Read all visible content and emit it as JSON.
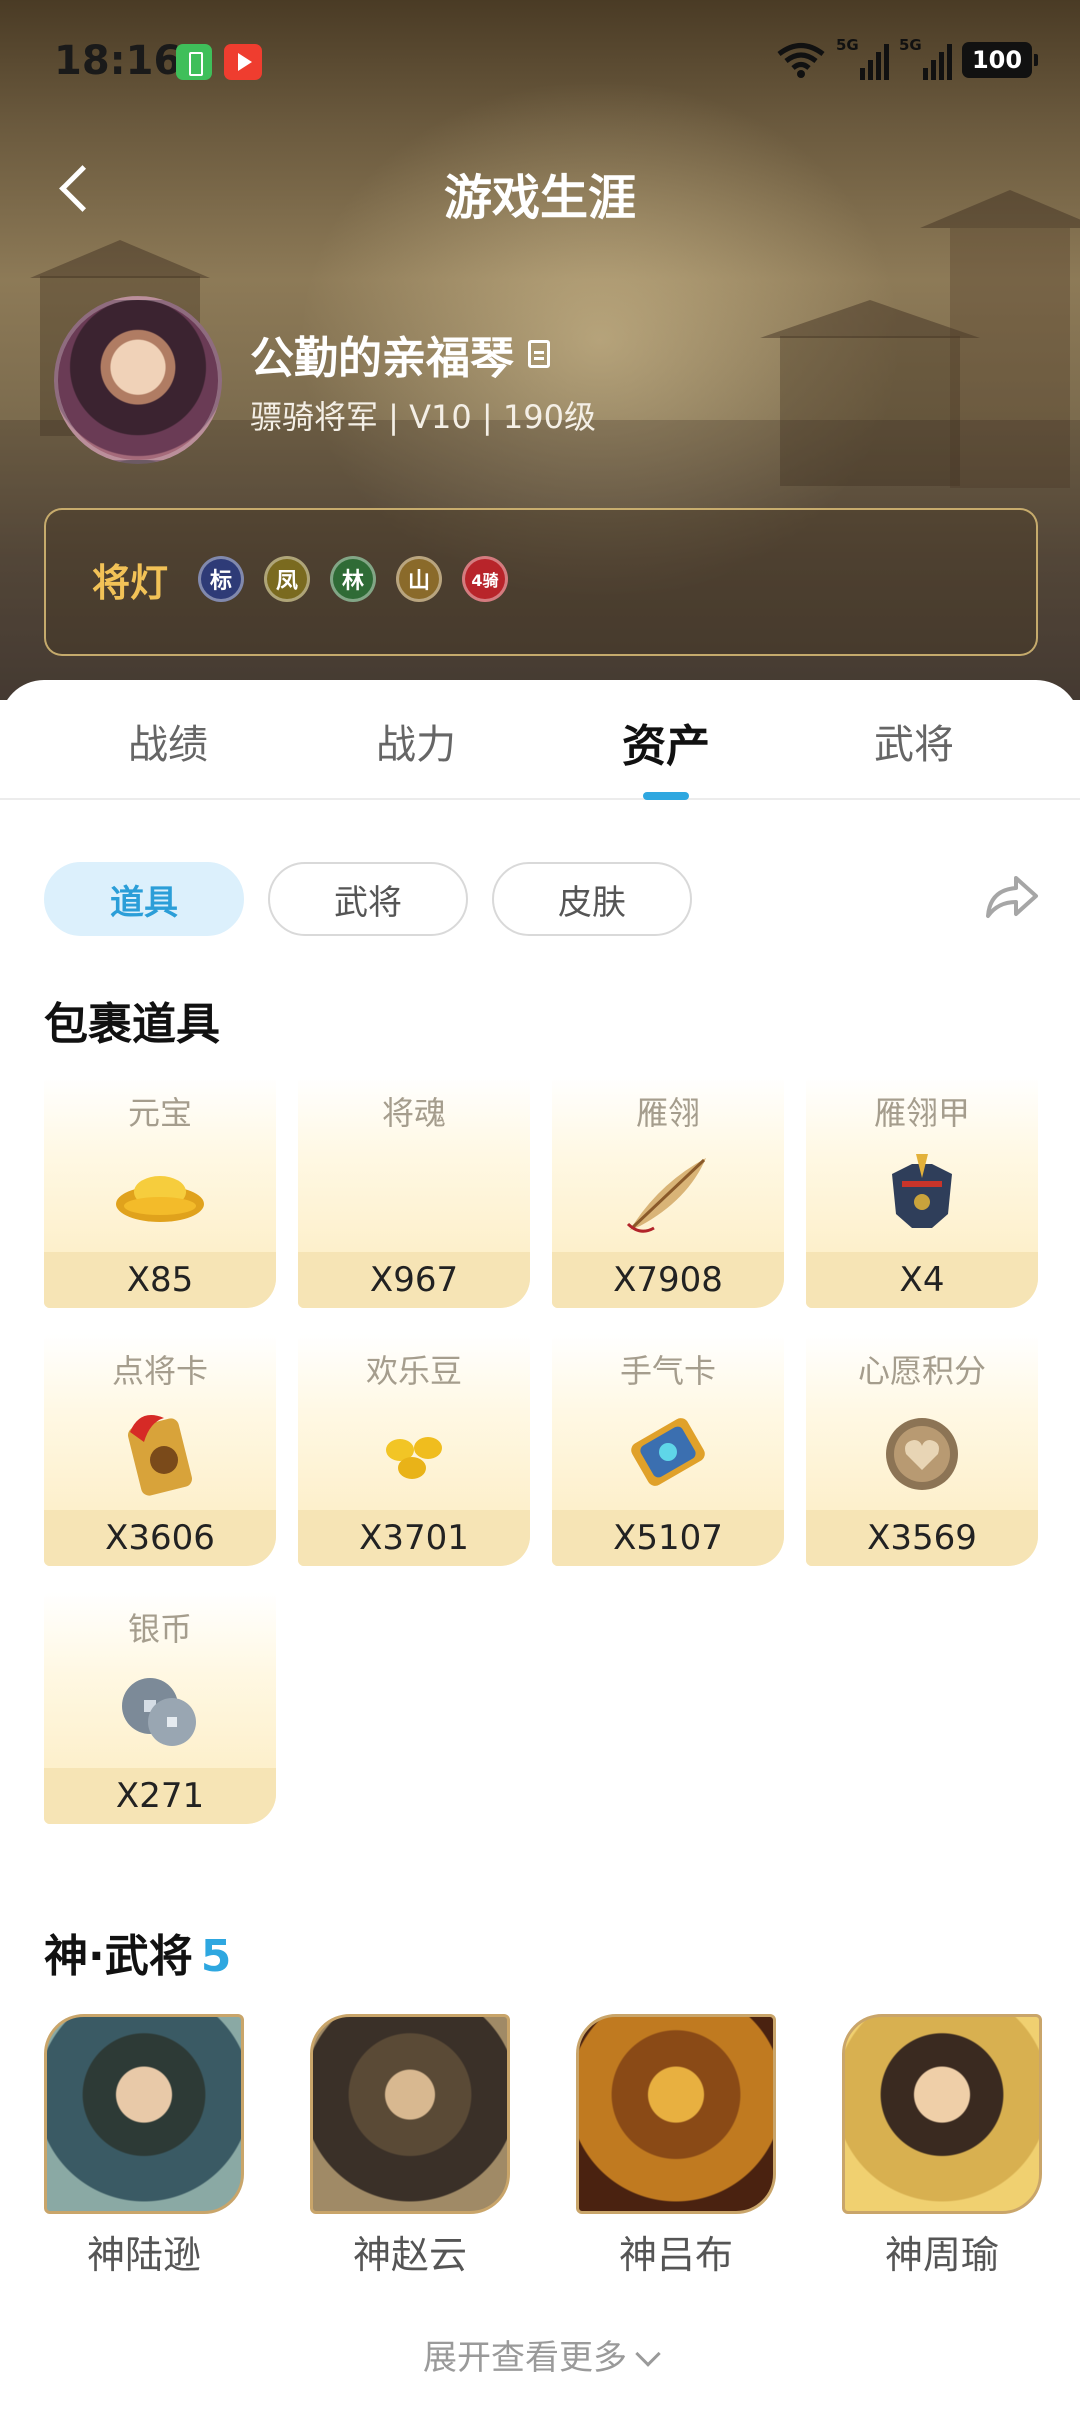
{
  "status_bar": {
    "time": "18:16",
    "signal1_label": "5G",
    "signal2_label": "5G",
    "battery": "100"
  },
  "header": {
    "title": "游戏生涯"
  },
  "profile": {
    "name": "公勤的亲福琴",
    "subtitle": "骠骑将军 | V10 | 190级"
  },
  "lamps": {
    "title": "将灯",
    "items": [
      "标",
      "凤",
      "林",
      "山",
      "4骑"
    ]
  },
  "tabs": [
    "战绩",
    "战力",
    "资产",
    "武将"
  ],
  "active_tab": "资产",
  "chips": [
    "道具",
    "武将",
    "皮肤"
  ],
  "active_chip": "道具",
  "inventory": {
    "title": "包裹道具",
    "items": [
      {
        "name": "元宝",
        "qty": "X85",
        "icon": "gold-ingot-icon"
      },
      {
        "name": "将魂",
        "qty": "X967",
        "icon": ""
      },
      {
        "name": "雁翎",
        "qty": "X7908",
        "icon": "feather-icon"
      },
      {
        "name": "雁翎甲",
        "qty": "X4",
        "icon": "armor-icon"
      },
      {
        "name": "点将卡",
        "qty": "X3606",
        "icon": "general-card-icon"
      },
      {
        "name": "欢乐豆",
        "qty": "X3701",
        "icon": "beans-icon"
      },
      {
        "name": "手气卡",
        "qty": "X5107",
        "icon": "luck-card-icon"
      },
      {
        "name": "心愿积分",
        "qty": "X3569",
        "icon": "heart-coin-icon"
      },
      {
        "name": "银币",
        "qty": "X271",
        "icon": "silver-coin-icon"
      }
    ]
  },
  "generals": {
    "title": "神·武将",
    "count": "5",
    "items": [
      {
        "name": "神陆逊"
      },
      {
        "name": "神赵云"
      },
      {
        "name": "神吕布"
      },
      {
        "name": "神周瑜"
      }
    ]
  },
  "expand_label": "展开查看更多",
  "colors": {
    "accent": "#2ea7e0",
    "gold": "#f2c257",
    "item_bg": "#fdf0cc"
  }
}
